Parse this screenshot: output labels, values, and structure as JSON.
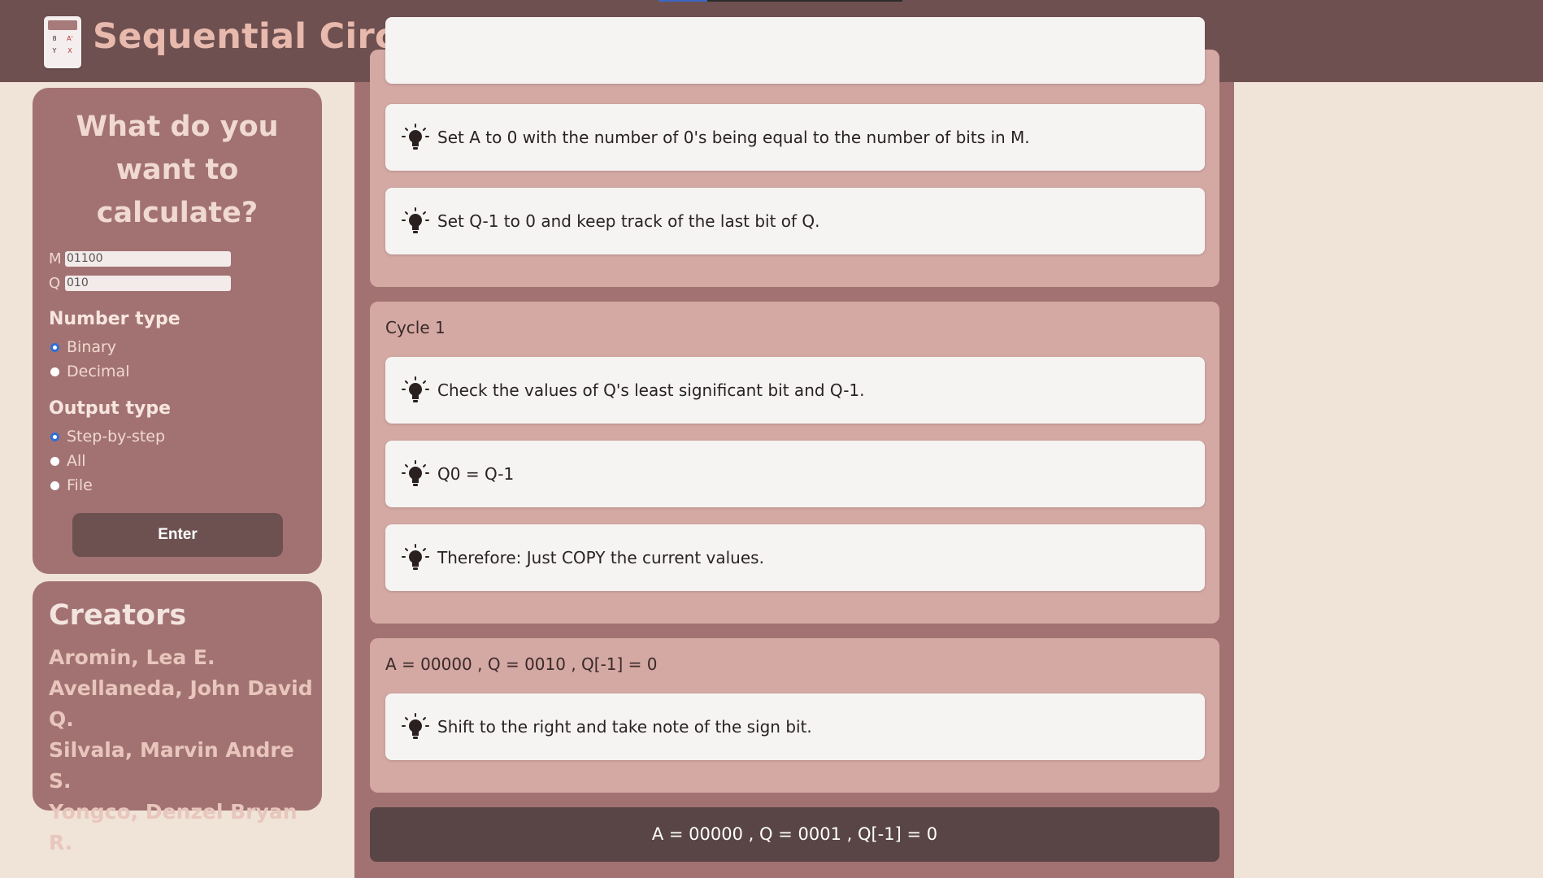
{
  "header": {
    "title": "Sequential Circuit Binary Multiplier",
    "logo_keys": [
      "8",
      "A'",
      "Y",
      "X"
    ]
  },
  "top_progress": {
    "fraction": 0.2
  },
  "form": {
    "heading": "What do you want to calculate?",
    "m_label": "M",
    "m_value": "01100",
    "q_label": "Q",
    "q_value": "010",
    "number_type_title": "Number type",
    "number_types": [
      "Binary",
      "Decimal"
    ],
    "number_type_selected": "Binary",
    "output_type_title": "Output type",
    "output_types": [
      "Step-by-step",
      "All",
      "File"
    ],
    "output_type_selected": "Step-by-step",
    "enter_label": "Enter"
  },
  "creators": {
    "title": "Creators",
    "names": [
      "Aromin, Lea E.",
      "Avellaneda, John David Q.",
      "Silvala, Marvin Andre S.",
      "Yongco, Denzel Bryan R."
    ]
  },
  "steps": {
    "init": [
      "Set A to 0 with the number of 0's being equal to the number of bits in M.",
      "Set Q-1 to 0 and keep track of the last bit of Q."
    ],
    "cycle1_title": "Cycle 1",
    "cycle1": [
      "Check the values of Q's least significant bit and Q-1.",
      "Q0 = Q-1",
      "Therefore: Just COPY the current values."
    ],
    "state_title": "A = 00000 , Q = 0010 , Q[-1] = 0",
    "state_steps": [
      "Shift to the right and take note of the sign bit."
    ],
    "result": "A = 00000 , Q = 0001 , Q[-1] = 0"
  }
}
